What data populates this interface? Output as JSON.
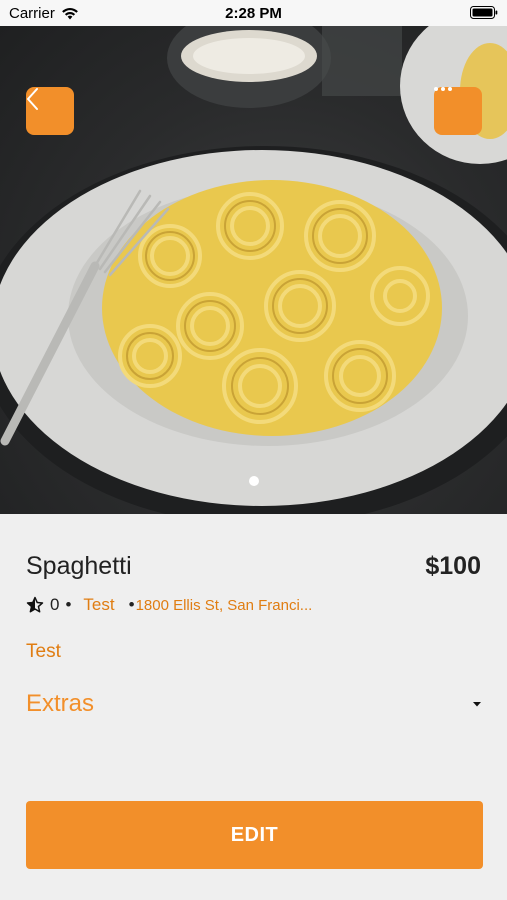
{
  "status_bar": {
    "carrier": "Carrier",
    "time": "2:28 PM",
    "icons": [
      "wifi-icon",
      "battery-icon"
    ]
  },
  "hero": {
    "image": "plate-of-spaghetti-with-fork",
    "page_count": 1,
    "active_page": 1
  },
  "nav": {
    "back_icon": "chevron-left-icon",
    "more_icon": "ellipsis-icon"
  },
  "item": {
    "name": "Spaghetti",
    "price": "$100",
    "rating": "0",
    "separator": "•",
    "vendor": "Test",
    "address_bullet": "•",
    "address": "1800 Ellis St, San Franci...",
    "description": "Test"
  },
  "extras": {
    "label": "Extras",
    "icon": "caret-down-icon"
  },
  "actions": {
    "edit_label": "EDIT"
  },
  "colors": {
    "accent": "#f28f2a",
    "accent_text": "#e07d12",
    "background": "#efefef"
  }
}
